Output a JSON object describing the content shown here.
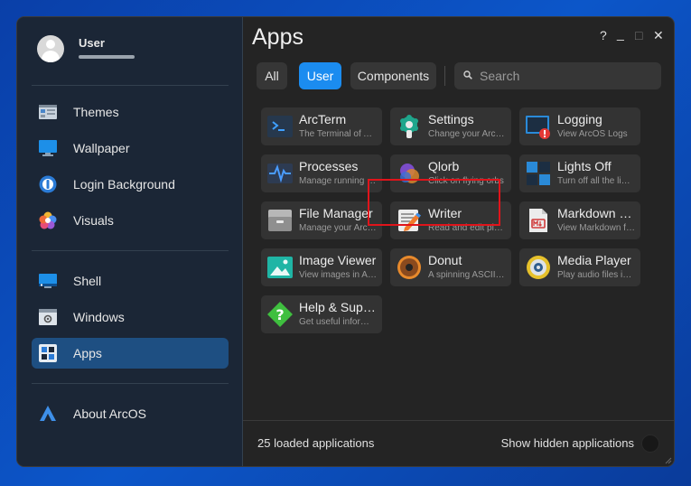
{
  "window": {
    "title": "Apps",
    "controls": [
      "?",
      "_",
      "□",
      "✕"
    ]
  },
  "user": {
    "name": "User"
  },
  "sidebar": {
    "groups": [
      [
        {
          "label": "Themes",
          "icon": "themes-icon"
        },
        {
          "label": "Wallpaper",
          "icon": "wallpaper-icon"
        },
        {
          "label": "Login Background",
          "icon": "login-background-icon"
        },
        {
          "label": "Visuals",
          "icon": "visuals-icon"
        }
      ],
      [
        {
          "label": "Shell",
          "icon": "shell-icon"
        },
        {
          "label": "Windows",
          "icon": "windows-icon"
        },
        {
          "label": "Apps",
          "icon": "apps-icon",
          "active": true
        }
      ],
      [
        {
          "label": "About ArcOS",
          "icon": "arcos-logo-icon"
        }
      ]
    ]
  },
  "filters": [
    {
      "label": "All",
      "active": false
    },
    {
      "label": "User",
      "active": true
    },
    {
      "label": "Components",
      "active": false
    }
  ],
  "search": {
    "placeholder": "Search"
  },
  "apps": [
    {
      "name": "ArcTerm",
      "desc": "The Terminal of ArcOS",
      "icon": "terminal-icon"
    },
    {
      "name": "Settings",
      "desc": "Change your ArcOS settings",
      "icon": "settings-icon"
    },
    {
      "name": "Logging",
      "desc": "View ArcOS Logs",
      "icon": "logging-icon"
    },
    {
      "name": "Processes",
      "desc": "Manage running processes",
      "icon": "processes-icon"
    },
    {
      "name": "Qlorb",
      "desc": "Click on flying orbs",
      "icon": "qlorb-icon"
    },
    {
      "name": "Lights Off",
      "desc": "Turn off all the lights",
      "icon": "lights-off-icon"
    },
    {
      "name": "File Manager",
      "desc": "Manage your ArcOS files",
      "icon": "file-manager-icon"
    },
    {
      "name": "Writer",
      "desc": "Read and edit plain text",
      "icon": "writer-icon"
    },
    {
      "name": "Markdown Viewer",
      "desc": "View Markdown files",
      "icon": "markdown-icon"
    },
    {
      "name": "Image Viewer",
      "desc": "View images in ArcOS",
      "icon": "image-viewer-icon"
    },
    {
      "name": "Donut",
      "desc": "A spinning ASCII donut",
      "icon": "donut-icon"
    },
    {
      "name": "Media Player",
      "desc": "Play audio files in ArcOS",
      "icon": "media-player-icon"
    },
    {
      "name": "Help & Support",
      "desc": "Get useful information",
      "icon": "help-icon"
    }
  ],
  "footer": {
    "count_text": "25 loaded applications",
    "hidden_label": "Show hidden applications",
    "hidden_enabled": false
  },
  "colors": {
    "accent": "#1b8cf0",
    "sidebar_active": "#1e4f82",
    "highlight": "#e0141b"
  }
}
